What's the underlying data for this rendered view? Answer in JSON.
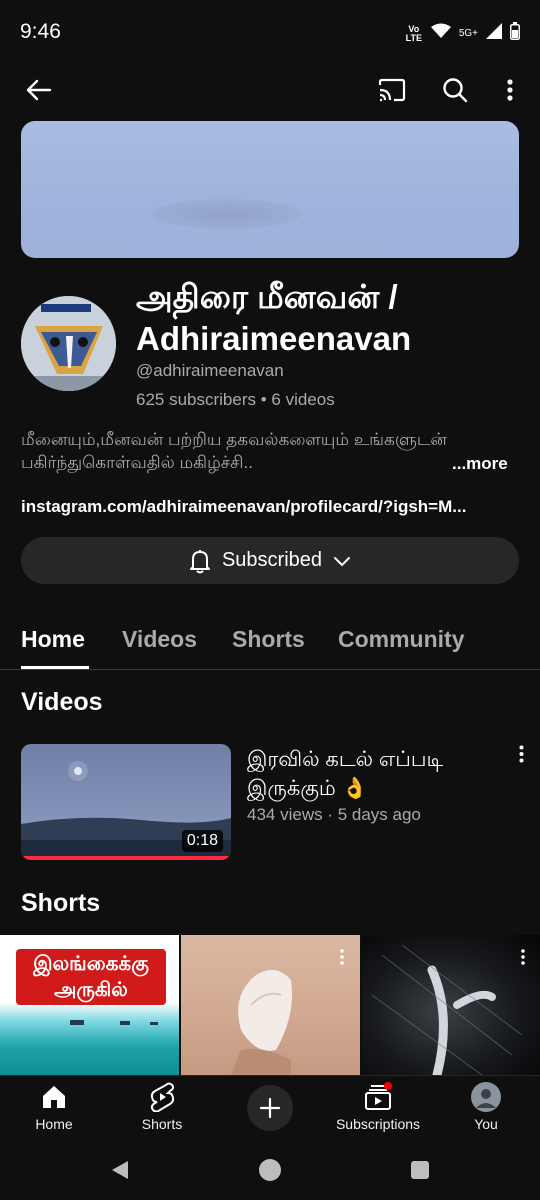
{
  "status_bar": {
    "time": "9:46",
    "network_badge": "Vo LTE",
    "network_type": "5G+"
  },
  "app_bar": {
    "back_icon": "arrow-left-icon",
    "cast_icon": "cast-icon",
    "search_icon": "search-icon",
    "more_icon": "more-vertical-icon"
  },
  "channel": {
    "name": "அதிரை மீனவன் / Adhiraimeenavan",
    "handle": "@adhiraimeenavan",
    "stats": "625 subscribers • 6 videos",
    "description": "மீனையும்,மீனவன் பற்றிய தகவல்களையும் உங்களுடன் பகிர்ந்துகொள்வதில் மகிழ்ச்சி..",
    "more_label": "...more",
    "link": "instagram.com/adhiraimeenavan/profilecard/?igsh=M..."
  },
  "subscribe": {
    "label": "Subscribed",
    "bell_icon": "bell-icon",
    "chevron_icon": "chevron-down-icon"
  },
  "tabs": [
    {
      "label": "Home",
      "active": true
    },
    {
      "label": "Videos",
      "active": false
    },
    {
      "label": "Shorts",
      "active": false
    },
    {
      "label": "Community",
      "active": false
    }
  ],
  "videos_section": {
    "title": "Videos",
    "items": [
      {
        "title": "இரவில் கடல் எப்படி இருக்கும் 👌",
        "meta": "434 views · 5 days ago",
        "duration": "0:18",
        "progress": 1.0
      }
    ]
  },
  "shorts_section": {
    "title": "Shorts",
    "items": [
      {
        "overlay_text": "இலங்கைக்கு அருகில்"
      },
      {
        "overlay_text": ""
      },
      {
        "overlay_text": ""
      }
    ]
  },
  "bottom_nav": [
    {
      "label": "Home",
      "icon": "home-icon"
    },
    {
      "label": "Shorts",
      "icon": "shorts-icon"
    },
    {
      "label": "",
      "icon": "plus-icon"
    },
    {
      "label": "Subscriptions",
      "icon": "subscriptions-icon"
    },
    {
      "label": "You",
      "icon": "avatar-icon"
    }
  ],
  "colors": {
    "background": "#0f0f0f",
    "surface": "#272727",
    "accent_red": "#ff2b3f",
    "text_secondary": "#aaaaaa"
  }
}
